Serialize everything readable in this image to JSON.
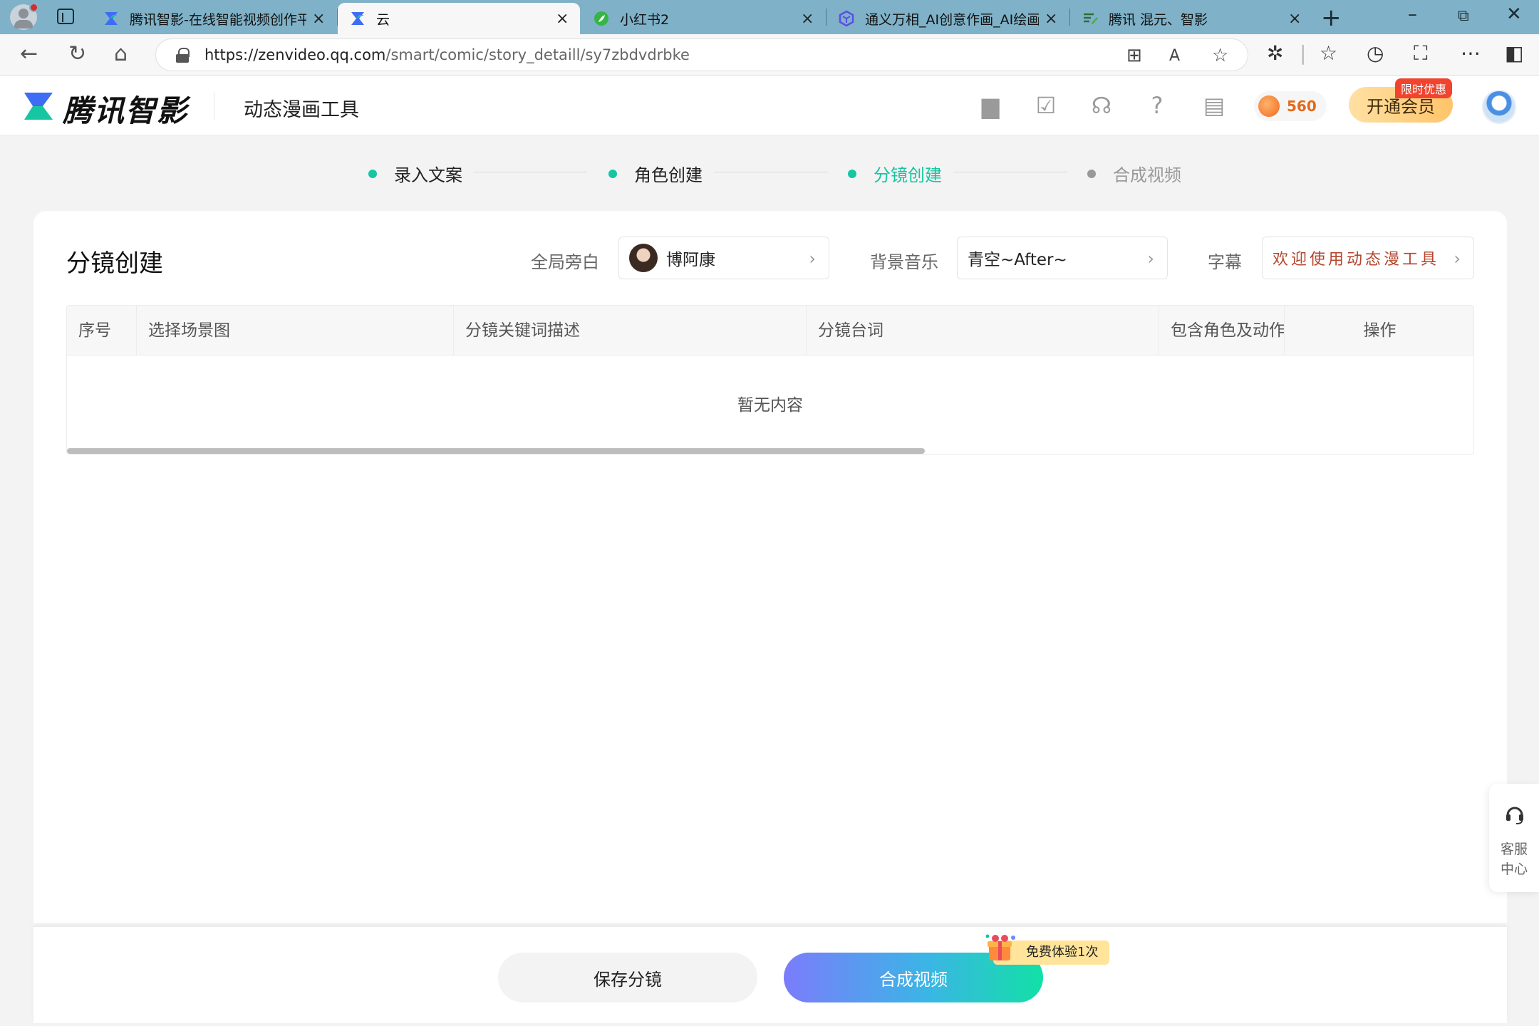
{
  "browser": {
    "tabs": [
      {
        "title": "腾讯智影-在线智能视频创作平台",
        "favicon": "zenvideo-logo",
        "active": false
      },
      {
        "title": "云",
        "favicon": "zenvideo-logo",
        "active": true
      },
      {
        "title": "小红书2",
        "favicon": "green-leaf",
        "active": false
      },
      {
        "title": "通义万相_AI创意作画_AI绘画_",
        "favicon": "tongyi-logo",
        "active": false
      },
      {
        "title": "腾讯 混元、智影",
        "favicon": "notes-icon",
        "active": false
      }
    ],
    "url_host": "https://zenvideo.qq.com",
    "url_path": "/smart/comic/story_detaill/sy7zbdvdrbke"
  },
  "app": {
    "brand": "腾讯智影",
    "product": "动态漫画工具",
    "points": "560",
    "vip_label": "开通会员",
    "vip_tag": "限时优惠"
  },
  "steps": [
    {
      "label": "录入文案",
      "state": "done"
    },
    {
      "label": "角色创建",
      "state": "done"
    },
    {
      "label": "分镜创建",
      "state": "active"
    },
    {
      "label": "合成视频",
      "state": "pending"
    }
  ],
  "panel": {
    "title": "分镜创建",
    "narration_label": "全局旁白",
    "narration_value": "博阿康",
    "bgm_label": "背景音乐",
    "bgm_value": "青空~After~",
    "subtitle_label": "字幕",
    "subtitle_value": "欢迎使用动态漫工具"
  },
  "table": {
    "columns": [
      "序号",
      "选择场景图",
      "分镜关键词描述",
      "分镜台词",
      "包含角色及动作",
      "操作"
    ],
    "empty_text": "暂无内容",
    "scroll_fraction": 0.61
  },
  "actions": {
    "save": "保存分镜",
    "compose": "合成视频",
    "free_badge": "免费体验1次"
  },
  "service": {
    "line1": "客服",
    "line2": "中心"
  },
  "colors": {
    "accent": "#16c5a2",
    "subtitle": "#b5452c",
    "points": "#e26a1a"
  }
}
